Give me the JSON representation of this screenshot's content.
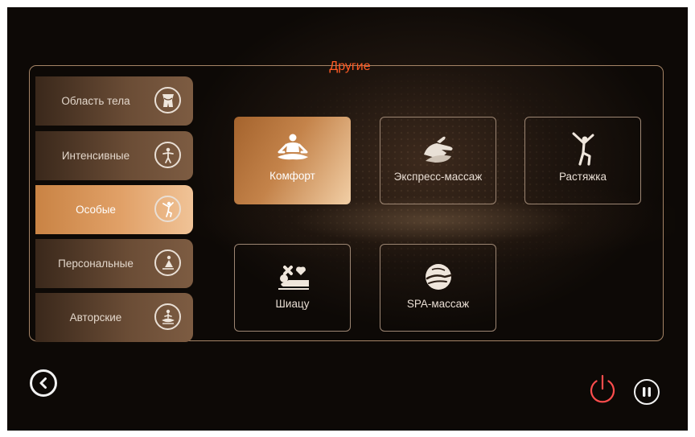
{
  "header": {
    "title": "Другие"
  },
  "sidebar": {
    "items": [
      {
        "label": "Область тела",
        "icon": "body-area-icon",
        "active": false
      },
      {
        "label": "Интенсивные",
        "icon": "intensive-figure-icon",
        "active": false
      },
      {
        "label": "Особые",
        "icon": "special-figure-icon",
        "active": true
      },
      {
        "label": "Персональные",
        "icon": "personal-stretch-icon",
        "active": false
      },
      {
        "label": "Авторские",
        "icon": "author-meditation-icon",
        "active": false
      }
    ]
  },
  "programs": {
    "items": [
      {
        "label": "Комфорт",
        "icon": "yoga-lotus-icon",
        "active": true
      },
      {
        "label": "Экспресс-массаж",
        "icon": "massage-hands-icon",
        "active": false
      },
      {
        "label": "Растяжка",
        "icon": "stretch-figure-icon",
        "active": false
      },
      {
        "label": "Шиацу",
        "icon": "shiatsu-icon",
        "active": false
      },
      {
        "label": "SPA-массаж",
        "icon": "spa-hand-icon",
        "active": false
      }
    ]
  },
  "controls": {
    "back": "back-chevron-icon",
    "power": "power-icon",
    "pause": "pause-icon"
  },
  "colors": {
    "accent": "#ff5a24",
    "power": "#ff4d4d",
    "active_gradient_start": "#c98344",
    "active_gradient_end": "#f0c397"
  }
}
